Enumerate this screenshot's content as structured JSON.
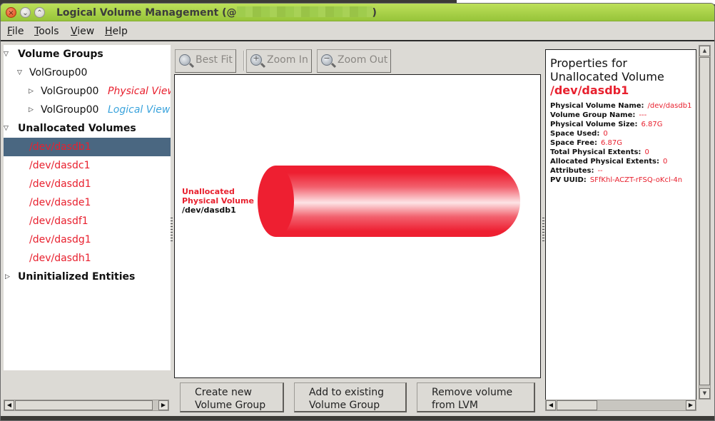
{
  "window": {
    "title_prefix": "Logical Volume Management (@",
    "title_suffix": ")",
    "close_glyph": "×",
    "min_glyph": "⌄",
    "max_glyph": "⌃"
  },
  "menubar": {
    "items": [
      {
        "mnemonic": "F",
        "rest": "ile"
      },
      {
        "mnemonic": "T",
        "rest": "ools"
      },
      {
        "mnemonic": "V",
        "rest": "iew"
      },
      {
        "mnemonic": "H",
        "rest": "elp"
      }
    ]
  },
  "tree": {
    "volume_groups": "Volume Groups",
    "volgroup": "VolGroup00",
    "physical_view": {
      "name": "VolGroup00",
      "view": "Physical View"
    },
    "logical_view": {
      "name": "VolGroup00",
      "view": "Logical View"
    },
    "unallocated": "Unallocated Volumes",
    "devices": [
      "/dev/dasdb1",
      "/dev/dasdc1",
      "/dev/dasdd1",
      "/dev/dasde1",
      "/dev/dasdf1",
      "/dev/dasdg1",
      "/dev/dasdh1"
    ],
    "selected_index": 0,
    "uninitialized": "Uninitialized Entities",
    "expanded_glyph": "▽",
    "collapsed_glyph": "▷"
  },
  "toolbar": {
    "best_fit": "Best Fit",
    "zoom_in": "Zoom In",
    "zoom_out": "Zoom Out"
  },
  "canvas": {
    "label_line1": "Unallocated",
    "label_line2": "Physical Volume",
    "label_device": "/dev/dasdb1"
  },
  "actions": {
    "create": [
      "Create new",
      "Volume Group"
    ],
    "add": [
      "Add to existing",
      "Volume Group"
    ],
    "remove": [
      "Remove volume",
      "from LVM"
    ]
  },
  "properties": {
    "title_line1": "Properties for",
    "title_line2": "Unallocated Volume",
    "device": "/dev/dasdb1",
    "rows": [
      {
        "label": "Physical Volume Name:",
        "value": "/dev/dasdb1"
      },
      {
        "label": "Volume Group Name:",
        "value": "---"
      },
      {
        "label": "Physical Volume Size:",
        "value": "6.87G"
      },
      {
        "label": "Space Used:",
        "value": "0"
      },
      {
        "label": "Space Free:",
        "value": "6.87G"
      },
      {
        "label": "Total Physical Extents:",
        "value": "0"
      },
      {
        "label": "Allocated Physical Extents:",
        "value": "0"
      },
      {
        "label": "Attributes:",
        "value": "--"
      },
      {
        "label": "PV UUID:",
        "value": "SFfKhl-ACZT-rFSQ-oKcl-4n"
      }
    ]
  },
  "scroll_glyphs": {
    "left": "◀",
    "right": "▶",
    "up": "▲",
    "down": "▼"
  }
}
